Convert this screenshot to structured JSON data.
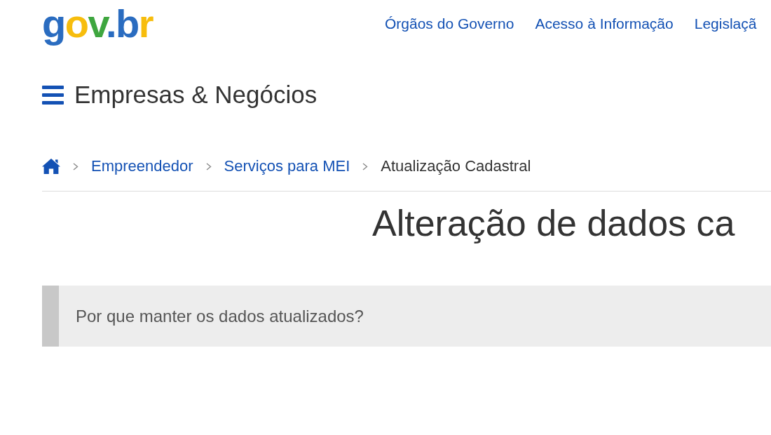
{
  "header": {
    "logo": "gov.br",
    "links": [
      "Órgãos do Governo",
      "Acesso à Informação",
      "Legislaçã"
    ]
  },
  "site_title": "Empresas & Negócios",
  "breadcrumb": [
    {
      "label": "Empreendedor",
      "current": false
    },
    {
      "label": "Serviços para MEI",
      "current": false
    },
    {
      "label": "Atualização Cadastral",
      "current": true
    }
  ],
  "page_title": "Alteração de dados ca",
  "accordion": {
    "title": "Por que manter os dados atualizados?"
  }
}
